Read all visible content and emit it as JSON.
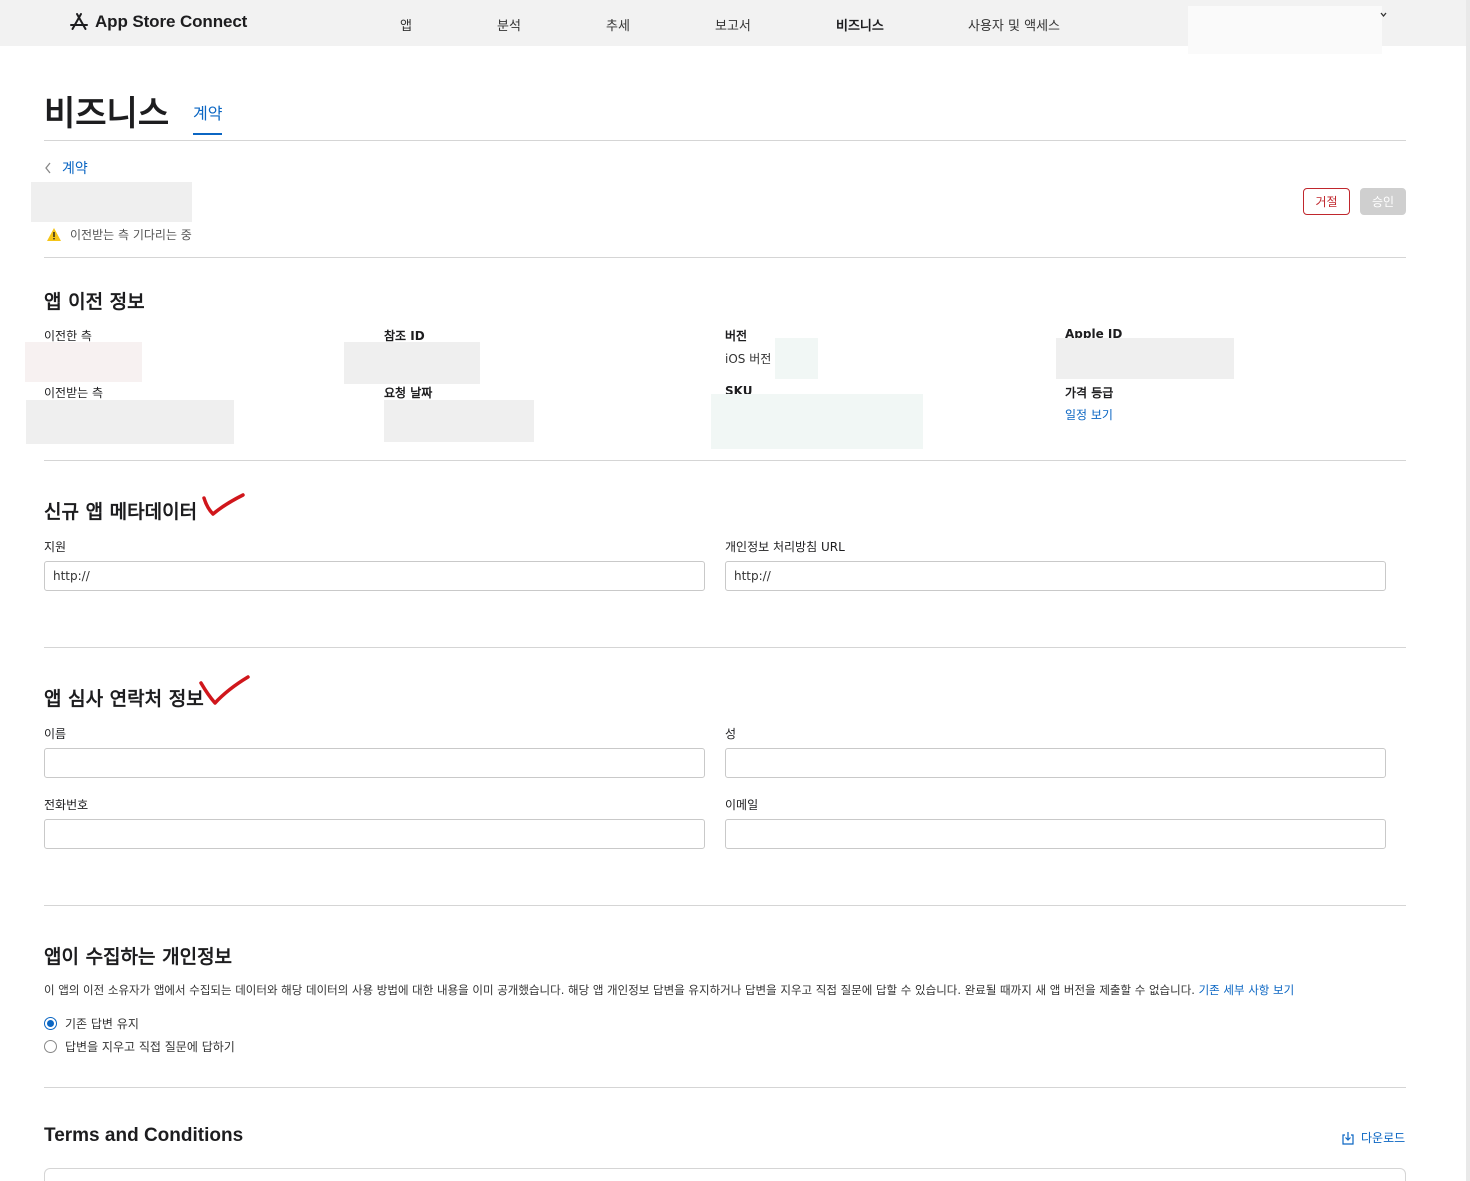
{
  "nav": {
    "brand": "App Store Connect",
    "items": [
      "앱",
      "분석",
      "추세",
      "보고서",
      "비즈니스",
      "사용자 및 액세스"
    ],
    "active": "비즈니스"
  },
  "header": {
    "title": "비즈니스",
    "tab": "계약"
  },
  "back": {
    "label": "계약"
  },
  "status": {
    "text": "이전받는 측 기다리는 중"
  },
  "actions": {
    "reject": "거절",
    "approve": "승인"
  },
  "transfer_info": {
    "title": "앱 이전 정보",
    "from_label": "이전한 측",
    "to_label": "이전받는 측",
    "ref_id_label": "참조 ID",
    "request_date_label": "요청 날짜",
    "version_label": "버전",
    "version_value": "iOS 버전",
    "sku_label": "SKU",
    "apple_id_label": "Apple ID",
    "price_tier_label": "가격 등급",
    "price_tier_link": "일정 보기"
  },
  "metadata": {
    "title": "신규 앱 메타데이터",
    "support_label": "지원",
    "support_value": "http://",
    "privacy_url_label": "개인정보 처리방침 URL",
    "privacy_url_value": "http://"
  },
  "review_contact": {
    "title": "앱 심사 연락처 정보",
    "first_name_label": "이름",
    "last_name_label": "성",
    "phone_label": "전화번호",
    "email_label": "이메일"
  },
  "privacy": {
    "title": "앱이 수집하는 개인정보",
    "description": "이 앱의 이전 소유자가 앱에서 수집되는 데이터와 해당 데이터의 사용 방법에 대한 내용을 이미 공개했습니다. 해당 앱 개인정보 답변을 유지하거나 답변을 지우고 직접 질문에 답할 수 있습니다. 완료될 때까지 새 앱 버전을 제출할 수 없습니다.",
    "details_link": "기존 세부 사항 보기",
    "options": [
      "기존 답변 유지",
      "답변을 지우고 직접 질문에 답하기"
    ],
    "selected_index": 0
  },
  "terms": {
    "title": "Terms and Conditions",
    "download": "다운로드"
  },
  "colors": {
    "accent": "#0b66c3",
    "reject": "#c0272d",
    "warning": "#f5c518",
    "annotation": "#d0161b"
  }
}
